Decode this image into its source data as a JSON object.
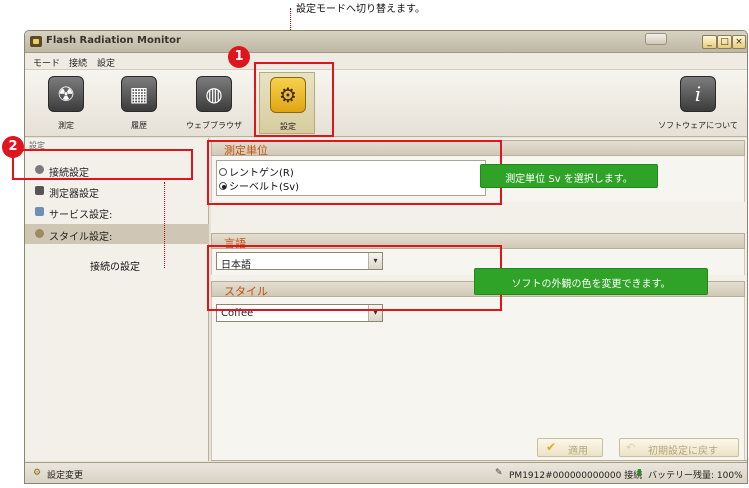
{
  "annotations": {
    "top_note": "設定モードへ切り替えます。",
    "conn_note": "接続の設定",
    "unit_note": "測定単位 Sv を選択します。",
    "style_note": "ソフトの外観の色を変更できます。",
    "num1": "1",
    "num2": "2"
  },
  "window": {
    "title": "Flash Radiation Monitor",
    "min_glyph": "_",
    "max_glyph": "□",
    "close_glyph": "×"
  },
  "menu": {
    "items": [
      "モード",
      "接続",
      "設定"
    ]
  },
  "toolbar": {
    "measure": "測定",
    "history": "履歴",
    "browser": "ウェブブラウザ",
    "settings": "設定",
    "about": "ソフトウェアについて",
    "glyphs": {
      "measure": "☢",
      "history": "▦",
      "browser": "◍",
      "settings": "⚙",
      "about": "i"
    }
  },
  "sidebar": {
    "header": "設定",
    "items": [
      "接続設定",
      "測定器設定",
      "サービス設定:",
      "スタイル設定:"
    ]
  },
  "sections": {
    "unit": {
      "title": "測定単位",
      "options": [
        "レントゲン(R)",
        "シーベルト(Sv)"
      ],
      "selected": "シーベルト(Sv)"
    },
    "language": {
      "title": "言語",
      "value": "日本語"
    },
    "style": {
      "title": "スタイル",
      "value": "Coffee"
    }
  },
  "buttons": {
    "apply": "適用",
    "reset": "初期設定に戻す",
    "apply_glyph": "✔",
    "reset_glyph": "↶",
    "arrow": "▾"
  },
  "status": {
    "left": "設定変更",
    "device": "PM1912#000000000000 接続",
    "battery": "バッテリー残量: 100%"
  },
  "colors": {
    "callout_red": "#e0141c",
    "note_green": "#2fa327",
    "section_title": "#c05010"
  }
}
